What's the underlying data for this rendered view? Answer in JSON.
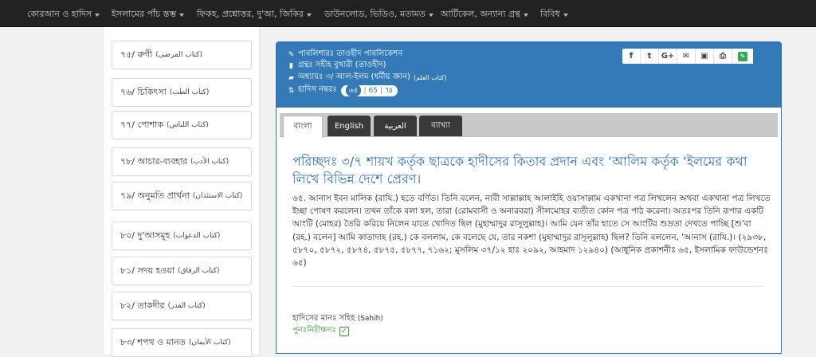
{
  "topnav": {
    "items": [
      {
        "label": "কোরআন ও হাদিস"
      },
      {
        "label": "ইসলামের পাঁচ স্তম্ভ"
      },
      {
        "label": "ফিকহ, প্রশ্নোত্তর, দু'আ, জিকির"
      },
      {
        "label": "ডাউনলোড, ভিডিও, মতামত"
      },
      {
        "label": "আর্টিকেল, অন্যান্য গ্রন্থ"
      },
      {
        "label": "বিবিধ"
      }
    ]
  },
  "sidebar": {
    "items": [
      {
        "bn": "৭৫/ রুগী",
        "ar": "(كتاب المرضى)"
      },
      {
        "bn": "৭৬/ চিকিৎসা",
        "ar": "(كتاب الطب)"
      },
      {
        "bn": "৭৭/ পোশাক",
        "ar": "(كتاب اللباس)"
      },
      {
        "bn": "৭৮/ আচার-ব্যবহার",
        "ar": "(كتاب الأدب)"
      },
      {
        "bn": "৭৯/ অনুমতি প্রার্থনা",
        "ar": "(كتاب الاستئذان)"
      },
      {
        "bn": "৮০/ দু'আসমূহ",
        "ar": "(كتاب الدعوات)"
      },
      {
        "bn": "৮১/ সদয় হওয়া",
        "ar": "(كتاب الرقاق)"
      },
      {
        "bn": "৮২/ তাকদীর",
        "ar": "(كتاب القدر)"
      },
      {
        "bn": "৮৩/ শপথ ও মানত",
        "ar": "(كتاب الأيمان)"
      }
    ]
  },
  "panel": {
    "publisher": "পাবলিশারঃ তাওহীদ পাবলিকেশন",
    "book": "গ্রন্থঃ সহীহ বুখারী (তাওহীদ)",
    "chapter": "অধ্যায়ঃ ৩/ আল-ইলম (ধর্মীয় জ্ঞান)",
    "chapter_ar": "(كتاب العلم)",
    "hadith_label": "হাদিস নম্বরঃ",
    "hadith_numbers": [
      "৬৫",
      "65",
      "٦٥"
    ],
    "icons": {
      "publisher": "pencil-icon",
      "book": "book-icon",
      "chapter": "folder-icon",
      "hadith": "sort-icon"
    }
  },
  "share": {
    "buttons": [
      "f",
      "t",
      "G+",
      "✉",
      "▣",
      "⎙",
      "✎"
    ]
  },
  "tabs": {
    "items": [
      "বাংলা",
      "English",
      "العربية",
      "ব্যাখ্যা"
    ]
  },
  "content": {
    "section_title": "পরিচ্ছদঃ ৩/৭ শায়খ কর্তৃক ছাত্রকে হাদীসের কিতাব প্রদান এবং ‘আলিম কর্তৃক ‘ইলমের কথা লিখে বিভিন্ন দেশে প্রেরণ।",
    "hadith_text": "৬৫. আনাস ইবন মালিক (রাযি.) হতে বর্ণিত। তিনি বলেন, নাবী সাল্লাল্লাহ আলাইহি ওয়াসাল্লাম একখানা পত্র লিখলেন অথবা একখানা পত্র লিখতে ইচ্ছা পোষণ করলেন। তখন তাঁকে বলা হল, তারা (রোমবাসী ও অনারবরা) সীলমোহর ব্যতীত কোন পত্র পাঠ করেনা। অতঃপর তিনি রূপার একটি আংটি (মোহর) তৈরি করিয়ে নিলেন যাতে খোদিত ছিল (মুহাম্মাদুর রাসূলুল্লাহ)। আমি যেন তাঁর হাতে সে আংটির শুভ্রতা দেখতে পাচ্ছি [শু'বা (রহ.) বলেন] আমি কাতাদাহ (রহ.) কে বললাম, কে বলেছে যে, তার নকশা (মুহাম্মাদুর রাসূলুল্লাহ) ছিল? তিনি বললেন, 'আনাস (রাযি.)। (২৯৩৮, ৫৮৭০, ৫৮৭২, ৫৮৭৪, ৫৮৭৫, ৫৮৭৭, ৭১৬২; মুসলিম ৩৭/১২ হাঃ ২০৯২, আহমাদ ১২৯৪০) (আধুনিক প্রকাশনীঃ ৬৫, ইসলামিক ফাউন্ডেশনঃ ৬৫)",
    "grade_label": "হাদিসের মানঃ",
    "grade_value": "সহিহ",
    "grade_en": "(Sahih)",
    "recheck_label": "পুনঃনিরীক্ষণঃ"
  },
  "colors": {
    "accent": "#337ab7",
    "title": "#2f6fb0",
    "nav_bg": "#222222",
    "recheck": "#3a9a3a"
  }
}
